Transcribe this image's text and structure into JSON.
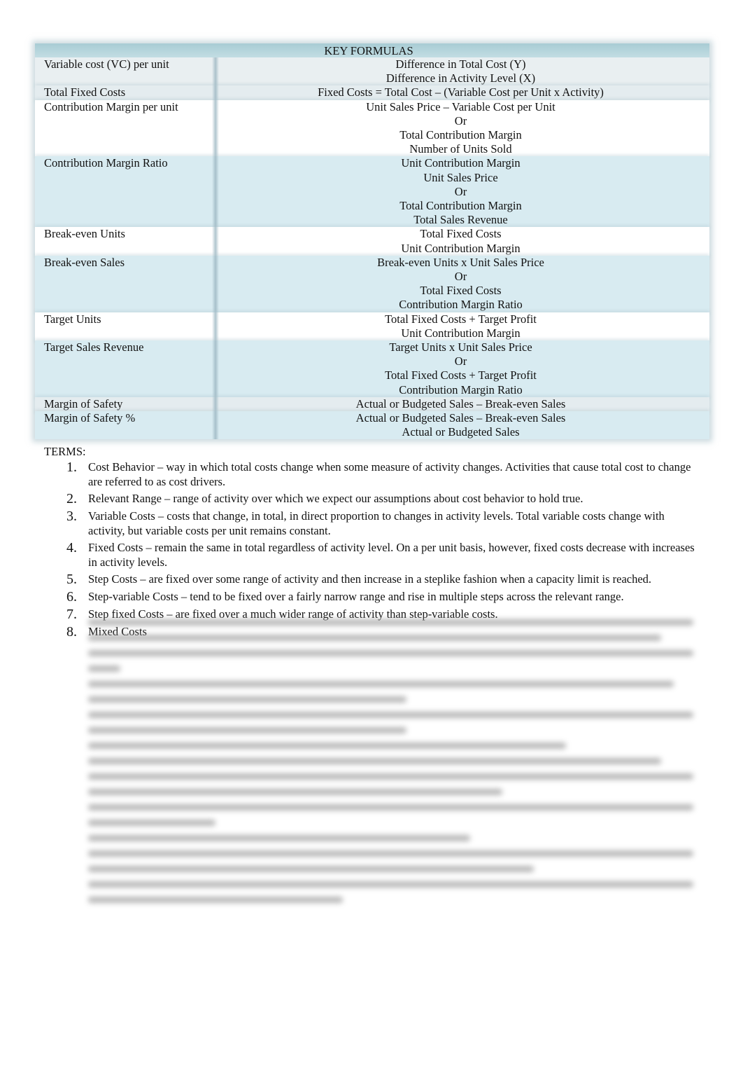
{
  "key_formulas": {
    "title": "KEY FORMULAS",
    "rows": [
      {
        "label": "Variable cost (VC) per unit",
        "lines": [
          "Difference in Total Cost (Y)",
          "Difference in Activity Level (X)"
        ]
      },
      {
        "label": "Total Fixed Costs",
        "lines": [
          "Fixed Costs = Total Cost – (Variable Cost per Unit x Activity)"
        ]
      },
      {
        "label": "Contribution Margin per unit",
        "lines": [
          "Unit Sales Price – Variable Cost per Unit",
          "Or",
          "Total Contribution Margin",
          "Number of Units Sold"
        ]
      },
      {
        "label": "Contribution Margin Ratio",
        "lines": [
          "Unit Contribution Margin",
          "Unit Sales Price",
          "Or",
          "Total Contribution Margin",
          "Total Sales Revenue"
        ]
      },
      {
        "label": "Break-even Units",
        "lines": [
          "Total Fixed Costs",
          "Unit Contribution Margin"
        ]
      },
      {
        "label": "Break-even Sales",
        "lines": [
          "Break-even Units x Unit Sales Price",
          "Or",
          "Total Fixed Costs",
          "Contribution Margin Ratio"
        ]
      },
      {
        "label": "Target Units",
        "lines": [
          "Total Fixed Costs + Target Profit",
          "Unit Contribution Margin"
        ]
      },
      {
        "label": "Target Sales Revenue",
        "lines": [
          "Target Units x Unit Sales Price",
          "Or",
          "Total Fixed Costs + Target Profit",
          "Contribution Margin Ratio"
        ]
      },
      {
        "label": "Margin of Safety",
        "lines": [
          "Actual or Budgeted Sales – Break-even Sales"
        ]
      },
      {
        "label": "Margin of Safety %",
        "lines": [
          "Actual or Budgeted Sales – Break-even Sales",
          "Actual or Budgeted Sales"
        ]
      }
    ]
  },
  "terms": {
    "label": "TERMS:",
    "items": [
      {
        "num": "1.",
        "name": "Cost Behavior",
        "definition": " – way in which total costs change when some measure of activity changes.  Activities that cause total cost to change are referred to as cost drivers."
      },
      {
        "num": "2.",
        "name": "Relevant Range",
        "definition": " – range of activity over which we expect our assumptions about cost behavior to hold true."
      },
      {
        "num": "3.",
        "name": "Variable Costs",
        "definition": " – costs that change, in total, in direct proportion to changes in activity levels.  Total variable costs   change with activity, but variable costs per unit   remains constant."
      },
      {
        "num": "4.",
        "name": "Fixed Costs",
        "definition": "– remain the same in total  regardless of activity level.  On a per unit  basis, however, fixed costs decrease with increases in activity levels."
      },
      {
        "num": "5.",
        "name": "Step Costs",
        "definition": " – are fixed over some range of activity and then increase in a steplike fashion when a capacity limit is reached."
      },
      {
        "num": "6.",
        "name": "Step-variable Costs",
        "definition": " – tend to be fixed over a fairly narrow range and rise in multiple steps across the relevant range."
      },
      {
        "num": "7.",
        "name": "Step fixed Costs",
        "definition": " – are fixed over a much wider range of activity than step-variable costs."
      },
      {
        "num": "8.",
        "name": "Mixed Costs",
        "definition": ""
      }
    ]
  }
}
